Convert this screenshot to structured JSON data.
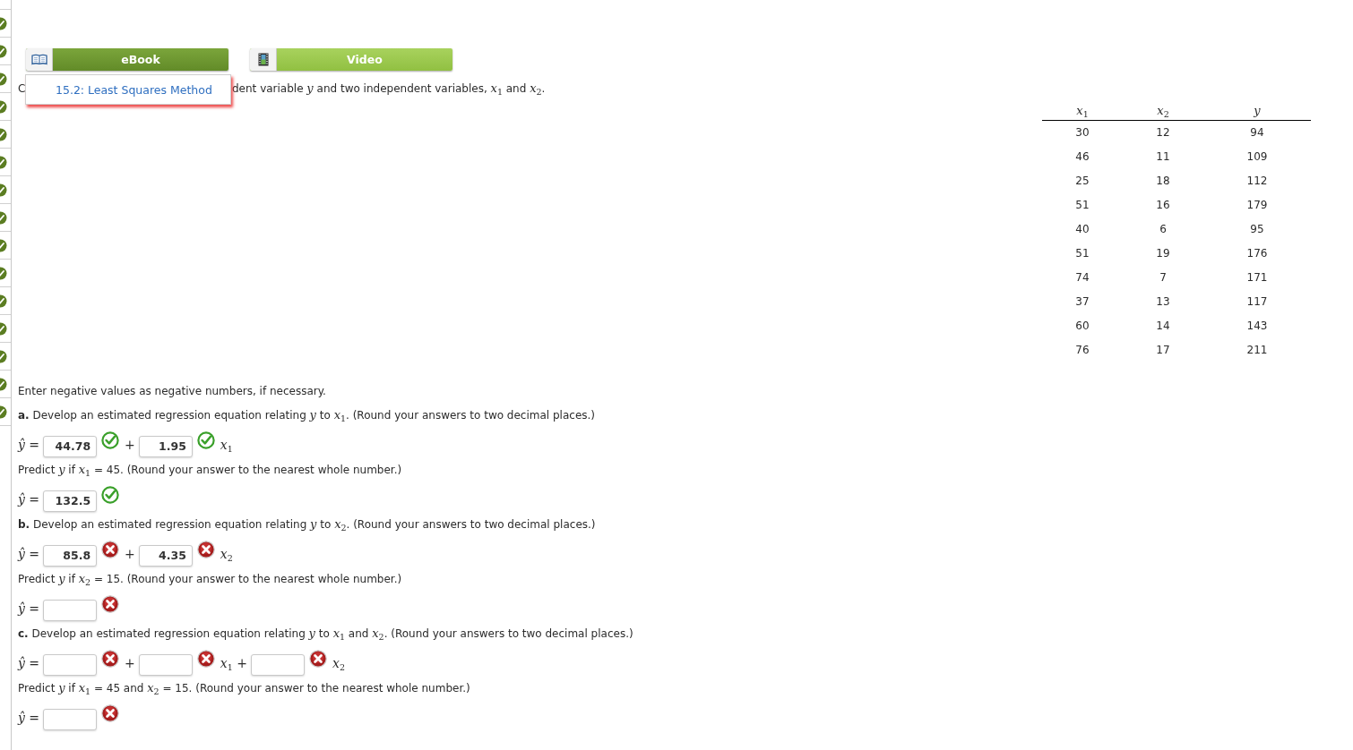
{
  "question_nav": [
    {
      "correct": true
    },
    {
      "correct": true
    },
    {
      "correct": true
    },
    {
      "correct": true
    },
    {
      "correct": true
    },
    {
      "correct": true
    },
    {
      "correct": true
    },
    {
      "correct": true
    },
    {
      "correct": true
    },
    {
      "correct": true
    },
    {
      "correct": true
    },
    {
      "correct": true
    },
    {
      "correct": true
    },
    {
      "correct": true
    },
    {
      "correct": true
    }
  ],
  "resources": [
    {
      "kind": "ebook",
      "label": "eBook",
      "expanded": true,
      "menu": [
        "15.2: Least Squares Method"
      ]
    },
    {
      "kind": "video",
      "label": "Video",
      "expanded": false
    }
  ],
  "intro_fragments": [
    "C",
    "dent variable *y* and two independent variables, *x*$_{1}$ and *x*$_{2}$."
  ],
  "data_table": {
    "columns": [
      "*x*$_{1}$",
      "*x*$_{2}$",
      "*y*"
    ],
    "rows": [
      [
        "30",
        "12",
        "94"
      ],
      [
        "46",
        "11",
        "109"
      ],
      [
        "25",
        "18",
        "112"
      ],
      [
        "51",
        "16",
        "179"
      ],
      [
        "40",
        "6",
        "95"
      ],
      [
        "51",
        "19",
        "176"
      ],
      [
        "74",
        "7",
        "171"
      ],
      [
        "37",
        "13",
        "117"
      ],
      [
        "60",
        "14",
        "143"
      ],
      [
        "76",
        "17",
        "211"
      ]
    ]
  },
  "rows": [
    {
      "kind": "text",
      "text": "Enter negative values as negative numbers, if necessary."
    },
    {
      "kind": "text",
      "text": "**a.** Develop an estimated regression equation relating *y* to *x*$_{1}$. (Round your answers to two decimal places.)"
    },
    {
      "kind": "equation",
      "lhs": "*ŷ* =",
      "items": [
        {
          "kind": "input",
          "value": "44.78",
          "correct": true
        },
        {
          "kind": "text",
          "text": "+"
        },
        {
          "kind": "input",
          "value": "1.95",
          "correct": true
        },
        {
          "kind": "text",
          "text": "*x*$_{1}$"
        }
      ]
    },
    {
      "kind": "text",
      "text": "Predict *y* if *x*$_{1}$ = 45. (Round your answer to the nearest whole number.)"
    },
    {
      "kind": "equation",
      "lhs": "*ŷ* =",
      "items": [
        {
          "kind": "input",
          "value": "132.5",
          "correct": true
        }
      ]
    },
    {
      "kind": "text",
      "text": "**b.** Develop an estimated regression equation relating *y* to *x*$_{2}$. (Round your answers to two decimal places.)"
    },
    {
      "kind": "equation",
      "lhs": "*ŷ* =",
      "items": [
        {
          "kind": "input",
          "value": "85.8",
          "correct": false
        },
        {
          "kind": "text",
          "text": "+"
        },
        {
          "kind": "input",
          "value": "4.35",
          "correct": false
        },
        {
          "kind": "text",
          "text": "*x*$_{2}$"
        }
      ]
    },
    {
      "kind": "text",
      "text": "Predict *y* if *x*$_{2}$ = 15. (Round your answer to the nearest whole number.)"
    },
    {
      "kind": "equation",
      "lhs": "*ŷ* =",
      "items": [
        {
          "kind": "input",
          "correct": false
        }
      ]
    },
    {
      "kind": "text",
      "text": "**c.** Develop an estimated regression equation relating *y* to *x*$_{1}$ and *x*$_{2}$. (Round your answers to two decimal places.)"
    },
    {
      "kind": "equation",
      "lhs": "*ŷ* =",
      "items": [
        {
          "kind": "input",
          "correct": false
        },
        {
          "kind": "text",
          "text": "+"
        },
        {
          "kind": "input",
          "correct": false
        },
        {
          "kind": "text",
          "text": "*x*$_{1}$ +"
        },
        {
          "kind": "input",
          "correct": false
        },
        {
          "kind": "text",
          "text": "*x*$_{2}$"
        }
      ]
    },
    {
      "kind": "text",
      "text": "Predict *y* if *x*$_{1}$ = 45 and *x*$_{2}$ = 15. (Round your answer to the nearest whole number.)"
    },
    {
      "kind": "equation",
      "lhs": "*ŷ* =",
      "items": [
        {
          "kind": "input",
          "correct": false
        }
      ]
    }
  ]
}
